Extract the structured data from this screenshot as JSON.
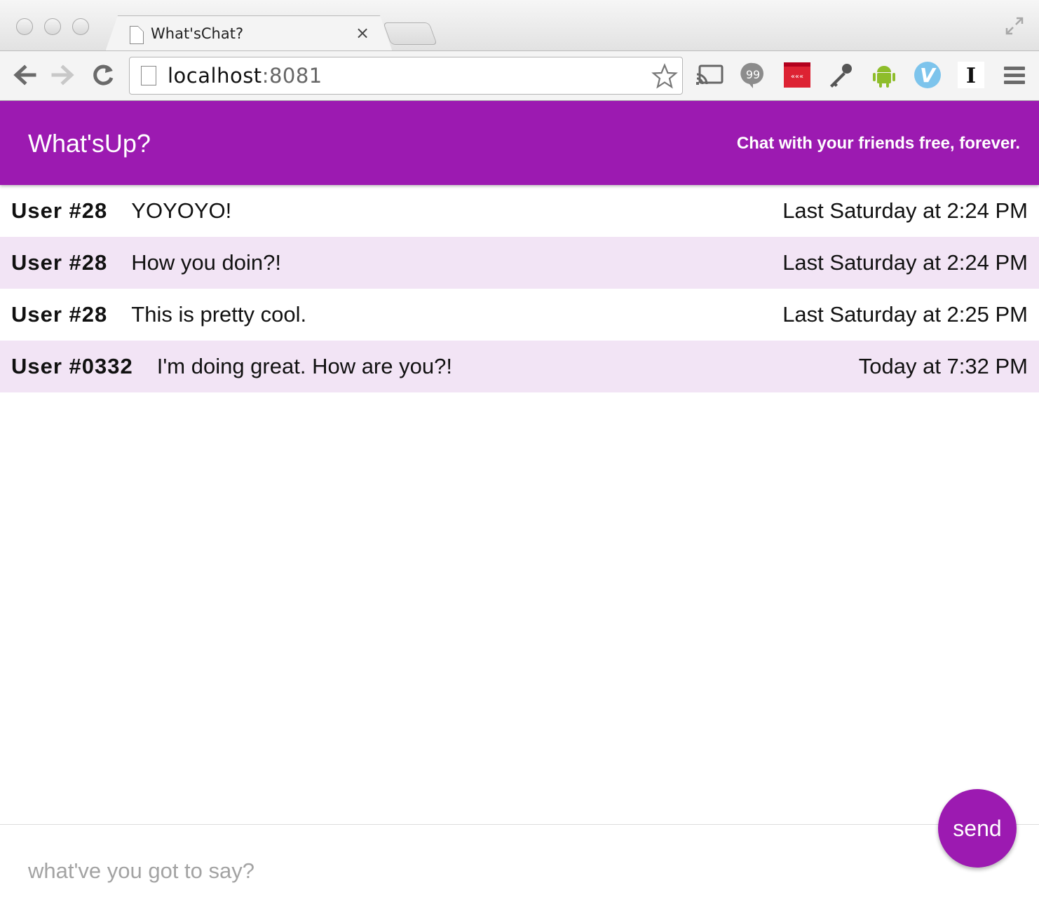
{
  "browser": {
    "tab_title": "What'sChat?",
    "tab_close": "×",
    "url_host": "localhost",
    "url_port": ":8081"
  },
  "header": {
    "title": "What'sUp?",
    "tagline": "Chat with your friends free, forever."
  },
  "messages": [
    {
      "user": "User #28",
      "text": "YOYOYO!",
      "time": "Last Saturday at 2:24 PM"
    },
    {
      "user": "User #28",
      "text": "How you doin?!",
      "time": "Last Saturday at 2:24 PM"
    },
    {
      "user": "User #28",
      "text": "This is pretty cool.",
      "time": "Last Saturday at 2:25 PM"
    },
    {
      "user": "User #0332",
      "text": "I'm doing great. How are you?!",
      "time": "Today at 7:32 PM"
    }
  ],
  "composer": {
    "placeholder": "what've you got to say?",
    "value": "",
    "send_label": "send"
  },
  "colors": {
    "accent": "#9c1ab1",
    "row_alt": "#f2e4f5"
  },
  "icons": {
    "extensions": [
      "cast-icon",
      "hangouts-icon",
      "pocket-ext-icon",
      "key-icon",
      "android-icon",
      "v-ext-icon",
      "i-ext-icon",
      "menu-icon"
    ]
  }
}
